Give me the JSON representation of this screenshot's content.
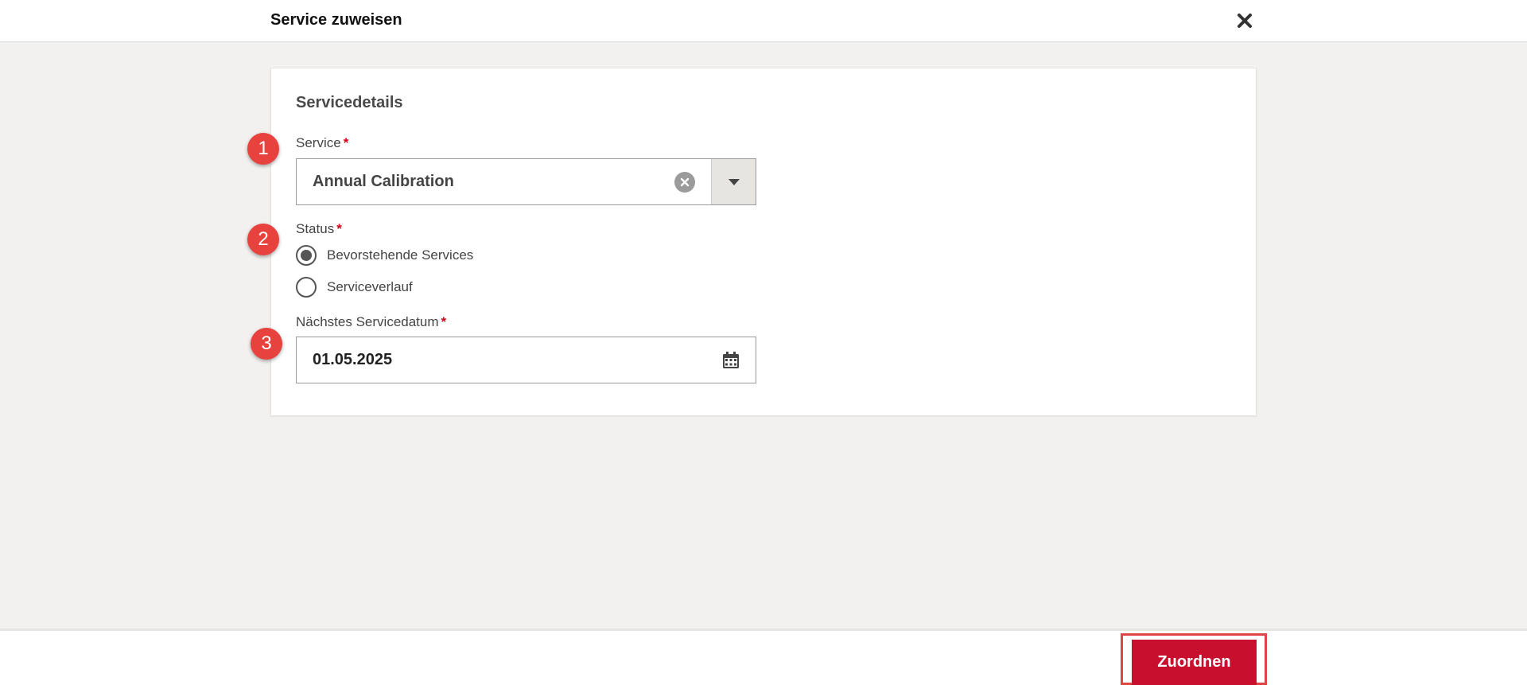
{
  "dialog": {
    "title": "Service zuweisen",
    "close_icon": "close-icon"
  },
  "card": {
    "section_title": "Servicedetails",
    "service": {
      "label": "Service",
      "required": "*",
      "value": "Annual Calibration"
    },
    "status": {
      "label": "Status",
      "required": "*",
      "options": [
        {
          "label": "Bevorstehende Services",
          "selected": true
        },
        {
          "label": "Serviceverlauf",
          "selected": false
        }
      ]
    },
    "next_date": {
      "label": "Nächstes Servicedatum",
      "required": "*",
      "value": "01.05.2025"
    }
  },
  "markers": [
    "1",
    "2",
    "3"
  ],
  "footer": {
    "assign_label": "Zuordnen"
  },
  "colors": {
    "primary_button": "#c8102e",
    "required": "#d0021b",
    "marker": "#e8423f",
    "highlight": "#e04545"
  }
}
